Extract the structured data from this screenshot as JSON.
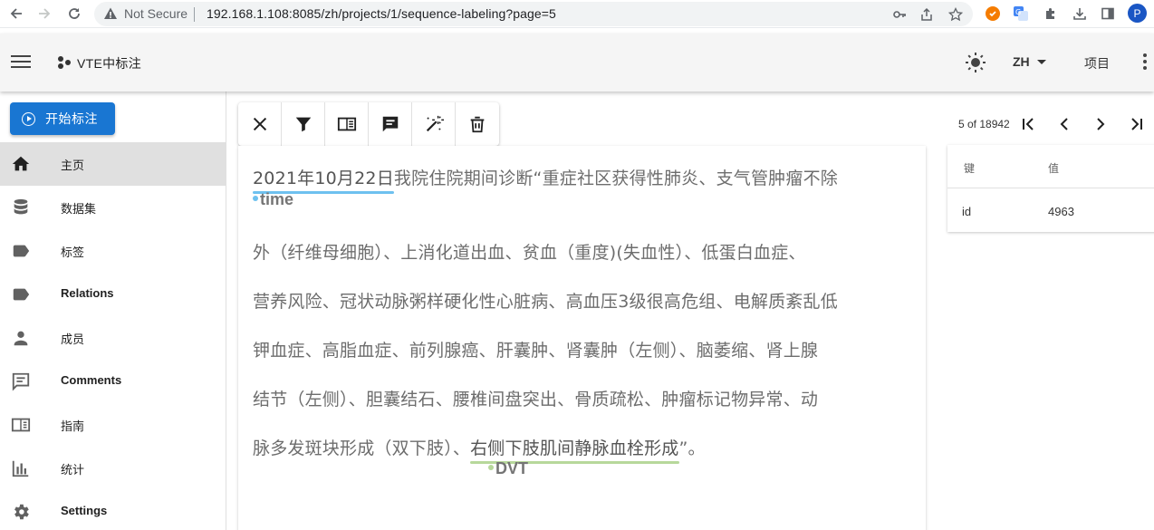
{
  "browser": {
    "security_label": "Not Secure",
    "url": "192.168.1.108:8085/zh/projects/1/sequence-labeling?page=5",
    "profile_initial": "P",
    "icons": [
      "back-icon",
      "forward-icon",
      "reload-icon",
      "warning-icon",
      "key-icon",
      "share-icon",
      "star-icon",
      "extension-icon",
      "download-icon",
      "sidebar-icon"
    ]
  },
  "appbar": {
    "title": "VTE中标注",
    "language": "ZH",
    "projects_label": "项目"
  },
  "sidebar": {
    "start_button": "开始标注",
    "items": [
      {
        "label": "主页",
        "icon": "home-icon",
        "active": true
      },
      {
        "label": "数据集",
        "icon": "database-icon",
        "active": false
      },
      {
        "label": "标签",
        "icon": "label-icon",
        "active": false
      },
      {
        "label": "Relations",
        "icon": "label-icon",
        "active": false
      },
      {
        "label": "成员",
        "icon": "person-icon",
        "active": false
      },
      {
        "label": "Comments",
        "icon": "comment-icon",
        "active": false
      },
      {
        "label": "指南",
        "icon": "book-icon",
        "active": false
      },
      {
        "label": "统计",
        "icon": "bar-chart-icon",
        "active": false
      },
      {
        "label": "Settings",
        "icon": "gear-icon",
        "active": false
      }
    ]
  },
  "toolbar": {
    "tools": [
      "close-icon",
      "filter-icon",
      "guideline-icon",
      "comment-icon",
      "auto-label-icon",
      "delete-icon"
    ]
  },
  "pagination": {
    "text": "5 of 18942"
  },
  "document": {
    "line1": {
      "entity": "2021年10月22日",
      "rest": "我院住院期间诊断“重症社区获得性肺炎、支气管肿瘤不除"
    },
    "line2": "外（纤维母细胞）、上消化道出血、贫血（重度)(失血性）、低蛋白血症、",
    "line3": "营养风险、冠状动脉粥样硬化性心脏病、高血压3级很高危组、电解质紊乱低",
    "line4": "钾血症、高脂血症、前列腺癌、肝囊肿、肾囊肿（左侧）、脑萎缩、肾上腺",
    "line5": "结节（左侧）、胆囊结石、腰椎间盘突出、骨质疏松、肿瘤标记物异常、动",
    "line7": {
      "before": "脉多发斑块形成（双下肢）、",
      "entity": "右侧下肢肌间静脉血栓形成",
      "after": "”。"
    },
    "labels": [
      {
        "name": "time",
        "color": "#6ec1ef"
      },
      {
        "name": "DVT",
        "color": "#b7d89b"
      }
    ]
  },
  "metadata": {
    "headers": [
      "键",
      "值"
    ],
    "rows": [
      {
        "key": "id",
        "value": "4963"
      }
    ]
  }
}
